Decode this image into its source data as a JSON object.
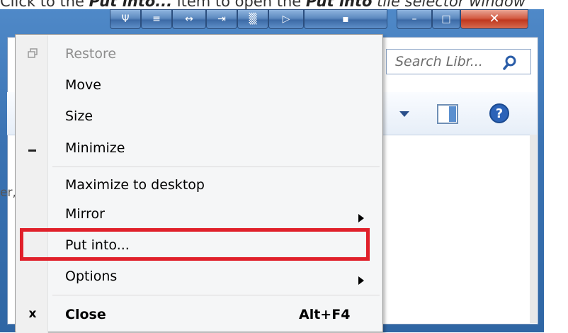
{
  "caption": {
    "prefix": "Click to the ",
    "item": "Put into...",
    "middle": " item to open the ",
    "window": "Put into",
    "suffix": " tile selector window"
  },
  "window": {
    "search_placeholder": "Search Libr...",
    "left_text": "er,"
  },
  "menu": {
    "items": [
      {
        "label": "Restore",
        "icon": "restore-icon",
        "disabled": true
      },
      {
        "label": "Move"
      },
      {
        "label": "Size"
      },
      {
        "label": "Minimize",
        "icon": "minimize-icon"
      },
      {
        "label": "Maximize to desktop"
      },
      {
        "label": "Mirror",
        "submenu": true
      },
      {
        "label": "Put into...",
        "highlighted": true
      },
      {
        "label": "Options",
        "submenu": true
      },
      {
        "label": "Close",
        "icon": "close-icon",
        "accelerator": "Alt+F4",
        "bold": true
      }
    ]
  },
  "colors": {
    "highlight": "#e0202a",
    "frame": "#3b73b3",
    "close_button": "#c0381f"
  }
}
